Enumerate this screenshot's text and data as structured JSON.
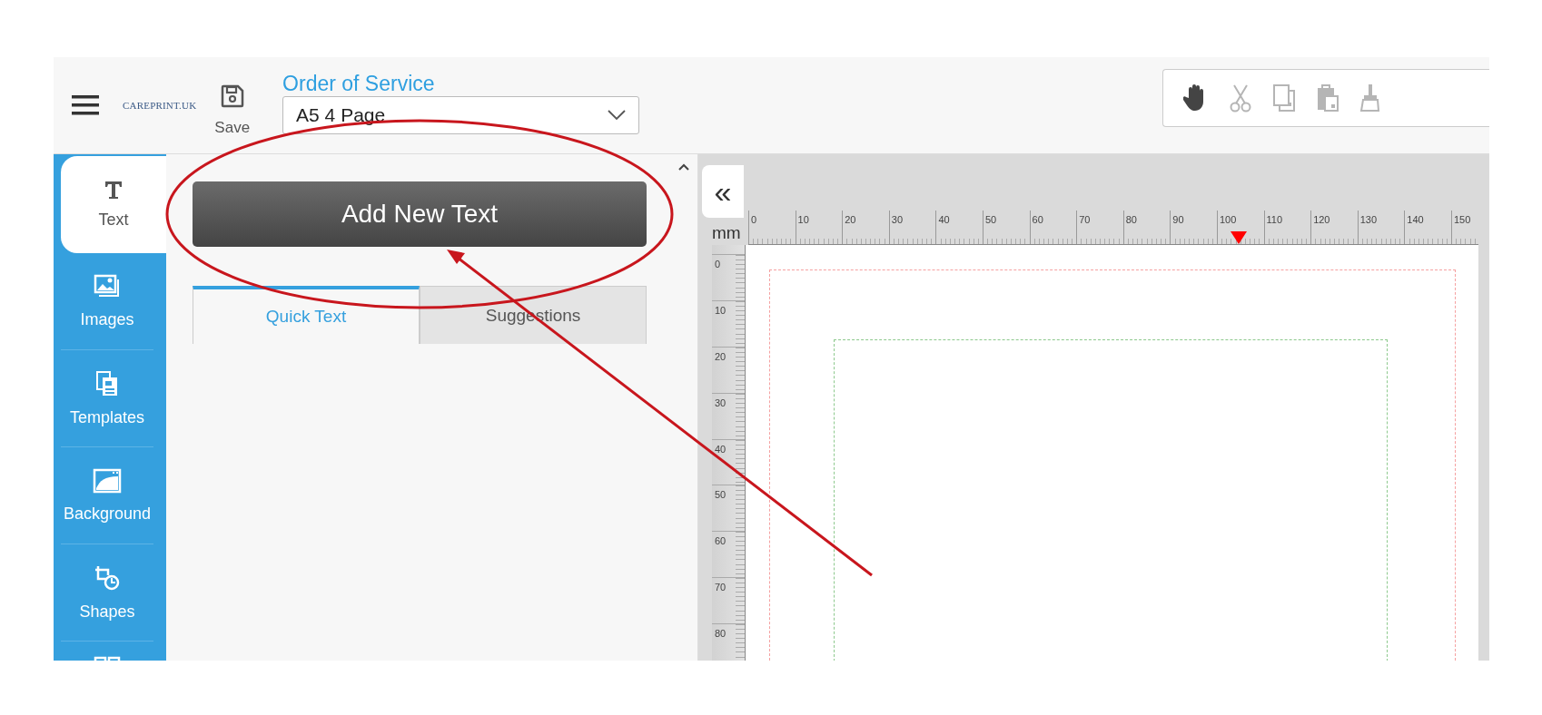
{
  "header": {
    "logo": "CAREPRINT.UK",
    "save_label": "Save",
    "document_title": "Order of Service",
    "format_select": {
      "value": "A5 4 Page"
    }
  },
  "toolbar": {
    "tools": [
      {
        "kind": "hand",
        "disabled": false
      },
      {
        "kind": "cut",
        "disabled": true
      },
      {
        "kind": "copy",
        "disabled": true
      },
      {
        "kind": "paste",
        "disabled": true
      },
      {
        "kind": "brush",
        "disabled": true
      }
    ]
  },
  "sidebar": {
    "items": [
      {
        "kind": "text",
        "label": "Text",
        "selected": true
      },
      {
        "kind": "images",
        "label": "Images",
        "selected": false
      },
      {
        "kind": "templates",
        "label": "Templates",
        "selected": false
      },
      {
        "kind": "background",
        "label": "Background",
        "selected": false
      },
      {
        "kind": "shapes",
        "label": "Shapes",
        "selected": false
      },
      {
        "kind": "grid",
        "selected": false
      }
    ]
  },
  "panel": {
    "add_button": "Add New Text",
    "tabs": [
      {
        "label": "Quick Text",
        "selected": true
      },
      {
        "label": "Suggestions",
        "selected": false
      }
    ]
  },
  "canvas": {
    "collapse_button": "«",
    "unit": "mm",
    "ruler_horizontal": [
      "0",
      "10",
      "20",
      "30",
      "40",
      "50",
      "60",
      "70",
      "80",
      "90",
      "100",
      "110",
      "120",
      "130",
      "140",
      "150"
    ],
    "ruler_vertical": [
      "0",
      "10",
      "20",
      "30",
      "40",
      "50",
      "60",
      "70",
      "80"
    ],
    "position_marker": {
      "level": 0.672
    }
  }
}
